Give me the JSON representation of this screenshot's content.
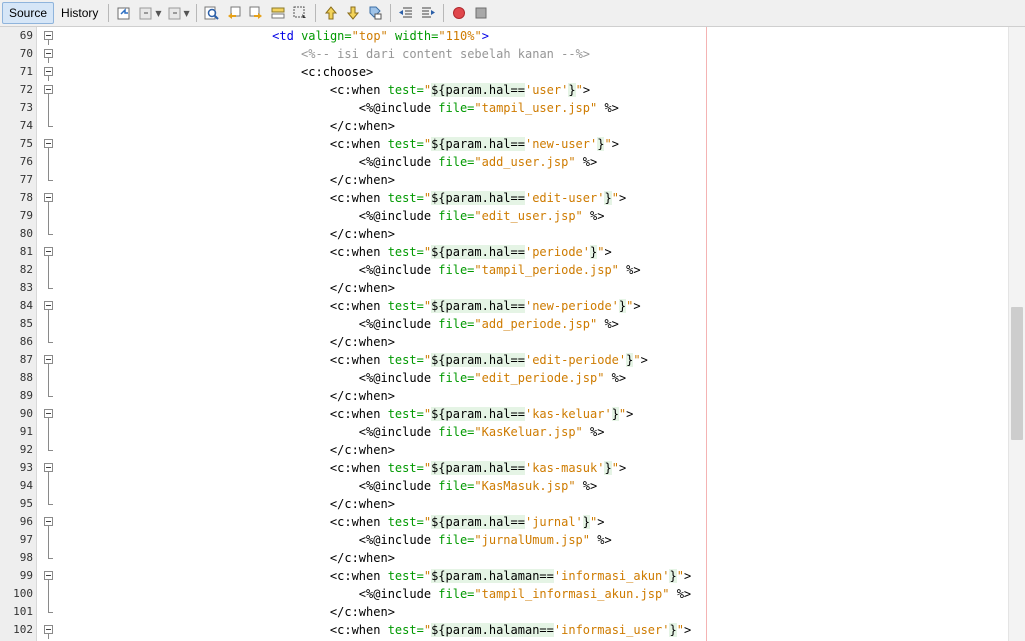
{
  "toolbar": {
    "tabs": [
      {
        "label": "Source",
        "active": true
      },
      {
        "label": "History",
        "active": false
      }
    ],
    "icons": [
      "last-edit-icon",
      "back-icon",
      "forward-icon",
      "find-icon",
      "find-previous-icon",
      "find-next-icon",
      "toggle-highlight-icon",
      "toggle-rectangular-selection-icon",
      "previous-bookmark-icon",
      "next-bookmark-icon",
      "toggle-bookmark-icon",
      "shift-left-icon",
      "shift-right-icon",
      "start-macro-icon",
      "stop-macro-icon"
    ],
    "record_color": "#e0474c"
  },
  "editor": {
    "lines": [
      {
        "n": "69",
        "indent": 28,
        "fold": "open",
        "parts": [
          [
            "tag",
            "<td "
          ],
          [
            "attr",
            "valign="
          ],
          [
            "str",
            "\"top\""
          ],
          [
            "attr",
            " width="
          ],
          [
            "str",
            "\"110%\""
          ],
          [
            "tag",
            ">"
          ]
        ]
      },
      {
        "n": "70",
        "indent": 32,
        "fold": "open",
        "parts": [
          [
            "cmt",
            "<%-- isi dari content sebelah kanan --%>"
          ]
        ]
      },
      {
        "n": "71",
        "indent": 32,
        "fold": "open",
        "parts": [
          [
            "el",
            "<c:choose>"
          ]
        ]
      },
      {
        "n": "72",
        "indent": 36,
        "fold": "open",
        "parts": [
          [
            "el",
            "<c:when "
          ],
          [
            "attr",
            "test="
          ],
          [
            "str",
            "\""
          ],
          [
            "hl",
            "${param.hal=="
          ],
          [
            "str",
            "'user'"
          ],
          [
            "hl",
            "}"
          ],
          [
            "str",
            "\""
          ],
          [
            "el",
            ">"
          ]
        ]
      },
      {
        "n": "73",
        "indent": 40,
        "fold": "line",
        "parts": [
          [
            "dir",
            "<%@include "
          ],
          [
            "attr",
            "file="
          ],
          [
            "str",
            "\"tampil_user.jsp\""
          ],
          [
            "dir",
            " %>"
          ]
        ]
      },
      {
        "n": "74",
        "indent": 36,
        "fold": "end",
        "parts": [
          [
            "el",
            "</c:when>"
          ]
        ]
      },
      {
        "n": "75",
        "indent": 36,
        "fold": "open",
        "parts": [
          [
            "el",
            "<c:when "
          ],
          [
            "attr",
            "test="
          ],
          [
            "str",
            "\""
          ],
          [
            "hl",
            "${param.hal=="
          ],
          [
            "str",
            "'new-user'"
          ],
          [
            "hl",
            "}"
          ],
          [
            "str",
            "\""
          ],
          [
            "el",
            ">"
          ]
        ]
      },
      {
        "n": "76",
        "indent": 40,
        "fold": "line",
        "parts": [
          [
            "dir",
            "<%@include "
          ],
          [
            "attr",
            "file="
          ],
          [
            "str",
            "\"add_user.jsp\""
          ],
          [
            "dir",
            " %>"
          ]
        ]
      },
      {
        "n": "77",
        "indent": 36,
        "fold": "end",
        "parts": [
          [
            "el",
            "</c:when>"
          ]
        ]
      },
      {
        "n": "78",
        "indent": 36,
        "fold": "open",
        "parts": [
          [
            "el",
            "<c:when "
          ],
          [
            "attr",
            "test="
          ],
          [
            "str",
            "\""
          ],
          [
            "hl",
            "${param.hal=="
          ],
          [
            "str",
            "'edit-user'"
          ],
          [
            "hl",
            "}"
          ],
          [
            "str",
            "\""
          ],
          [
            "el",
            ">"
          ]
        ]
      },
      {
        "n": "79",
        "indent": 40,
        "fold": "line",
        "parts": [
          [
            "dir",
            "<%@include "
          ],
          [
            "attr",
            "file="
          ],
          [
            "str",
            "\"edit_user.jsp\""
          ],
          [
            "dir",
            " %>"
          ]
        ]
      },
      {
        "n": "80",
        "indent": 36,
        "fold": "end",
        "parts": [
          [
            "el",
            "</c:when>"
          ]
        ]
      },
      {
        "n": "81",
        "indent": 36,
        "fold": "open",
        "parts": [
          [
            "el",
            "<c:when "
          ],
          [
            "attr",
            "test="
          ],
          [
            "str",
            "\""
          ],
          [
            "hl",
            "${param.hal=="
          ],
          [
            "str",
            "'periode'"
          ],
          [
            "hl",
            "}"
          ],
          [
            "str",
            "\""
          ],
          [
            "el",
            ">"
          ]
        ]
      },
      {
        "n": "82",
        "indent": 40,
        "fold": "line",
        "parts": [
          [
            "dir",
            "<%@include "
          ],
          [
            "attr",
            "file="
          ],
          [
            "str",
            "\"tampil_periode.jsp\""
          ],
          [
            "dir",
            " %>"
          ]
        ]
      },
      {
        "n": "83",
        "indent": 36,
        "fold": "end",
        "parts": [
          [
            "el",
            "</c:when>"
          ]
        ]
      },
      {
        "n": "84",
        "indent": 36,
        "fold": "open",
        "parts": [
          [
            "el",
            "<c:when "
          ],
          [
            "attr",
            "test="
          ],
          [
            "str",
            "\""
          ],
          [
            "hl",
            "${param.hal=="
          ],
          [
            "str",
            "'new-periode'"
          ],
          [
            "hl",
            "}"
          ],
          [
            "str",
            "\""
          ],
          [
            "el",
            ">"
          ]
        ]
      },
      {
        "n": "85",
        "indent": 40,
        "fold": "line",
        "parts": [
          [
            "dir",
            "<%@include "
          ],
          [
            "attr",
            "file="
          ],
          [
            "str",
            "\"add_periode.jsp\""
          ],
          [
            "dir",
            " %>"
          ]
        ]
      },
      {
        "n": "86",
        "indent": 36,
        "fold": "end",
        "parts": [
          [
            "el",
            "</c:when>"
          ]
        ]
      },
      {
        "n": "87",
        "indent": 36,
        "fold": "open",
        "parts": [
          [
            "el",
            "<c:when "
          ],
          [
            "attr",
            "test="
          ],
          [
            "str",
            "\""
          ],
          [
            "hl",
            "${param.hal=="
          ],
          [
            "str",
            "'edit-periode'"
          ],
          [
            "hl",
            "}"
          ],
          [
            "str",
            "\""
          ],
          [
            "el",
            ">"
          ]
        ]
      },
      {
        "n": "88",
        "indent": 40,
        "fold": "line",
        "parts": [
          [
            "dir",
            "<%@include "
          ],
          [
            "attr",
            "file="
          ],
          [
            "str",
            "\"edit_periode.jsp\""
          ],
          [
            "dir",
            " %>"
          ]
        ]
      },
      {
        "n": "89",
        "indent": 36,
        "fold": "end",
        "parts": [
          [
            "el",
            "</c:when>"
          ]
        ]
      },
      {
        "n": "90",
        "indent": 36,
        "fold": "open",
        "parts": [
          [
            "el",
            "<c:when "
          ],
          [
            "attr",
            "test="
          ],
          [
            "str",
            "\""
          ],
          [
            "hl",
            "${param.hal=="
          ],
          [
            "str",
            "'kas-keluar'"
          ],
          [
            "hl",
            "}"
          ],
          [
            "str",
            "\""
          ],
          [
            "el",
            ">"
          ]
        ]
      },
      {
        "n": "91",
        "indent": 40,
        "fold": "line",
        "parts": [
          [
            "dir",
            "<%@include "
          ],
          [
            "attr",
            "file="
          ],
          [
            "str",
            "\"KasKeluar.jsp\""
          ],
          [
            "dir",
            " %>"
          ]
        ]
      },
      {
        "n": "92",
        "indent": 36,
        "fold": "end",
        "parts": [
          [
            "el",
            "</c:when>"
          ]
        ]
      },
      {
        "n": "93",
        "indent": 36,
        "fold": "open",
        "parts": [
          [
            "el",
            "<c:when "
          ],
          [
            "attr",
            "test="
          ],
          [
            "str",
            "\""
          ],
          [
            "hl",
            "${param.hal=="
          ],
          [
            "str",
            "'kas-masuk'"
          ],
          [
            "hl",
            "}"
          ],
          [
            "str",
            "\""
          ],
          [
            "el",
            ">"
          ]
        ]
      },
      {
        "n": "94",
        "indent": 40,
        "fold": "line",
        "parts": [
          [
            "dir",
            "<%@include "
          ],
          [
            "attr",
            "file="
          ],
          [
            "str",
            "\"KasMasuk.jsp\""
          ],
          [
            "dir",
            " %>"
          ]
        ]
      },
      {
        "n": "95",
        "indent": 36,
        "fold": "end",
        "parts": [
          [
            "el",
            "</c:when>"
          ]
        ]
      },
      {
        "n": "96",
        "indent": 36,
        "fold": "open",
        "parts": [
          [
            "el",
            "<c:when "
          ],
          [
            "attr",
            "test="
          ],
          [
            "str",
            "\""
          ],
          [
            "hl",
            "${param.hal=="
          ],
          [
            "str",
            "'jurnal'"
          ],
          [
            "hl",
            "}"
          ],
          [
            "str",
            "\""
          ],
          [
            "el",
            ">"
          ]
        ]
      },
      {
        "n": "97",
        "indent": 40,
        "fold": "line",
        "parts": [
          [
            "dir",
            "<%@include "
          ],
          [
            "attr",
            "file="
          ],
          [
            "str",
            "\"jurnalUmum.jsp\""
          ],
          [
            "dir",
            " %>"
          ]
        ]
      },
      {
        "n": "98",
        "indent": 36,
        "fold": "end",
        "parts": [
          [
            "el",
            "</c:when>"
          ]
        ]
      },
      {
        "n": "99",
        "indent": 36,
        "fold": "open",
        "parts": [
          [
            "el",
            "<c:when "
          ],
          [
            "attr",
            "test="
          ],
          [
            "str",
            "\""
          ],
          [
            "hl",
            "${param.halaman=="
          ],
          [
            "str",
            "'informasi_akun'"
          ],
          [
            "hl",
            "}"
          ],
          [
            "str",
            "\""
          ],
          [
            "el",
            ">"
          ]
        ]
      },
      {
        "n": "100",
        "indent": 40,
        "fold": "line",
        "parts": [
          [
            "dir",
            "<%@include "
          ],
          [
            "attr",
            "file="
          ],
          [
            "str",
            "\"tampil_informasi_akun.jsp\""
          ],
          [
            "dir",
            " %>"
          ]
        ]
      },
      {
        "n": "101",
        "indent": 36,
        "fold": "end",
        "parts": [
          [
            "el",
            "</c:when>"
          ]
        ]
      },
      {
        "n": "102",
        "indent": 36,
        "fold": "open",
        "parts": [
          [
            "el",
            "<c:when "
          ],
          [
            "attr",
            "test="
          ],
          [
            "str",
            "\""
          ],
          [
            "hl",
            "${param.halaman=="
          ],
          [
            "str",
            "'informasi_user'"
          ],
          [
            "hl",
            "}"
          ],
          [
            "str",
            "\""
          ],
          [
            "el",
            ">"
          ]
        ]
      }
    ]
  }
}
